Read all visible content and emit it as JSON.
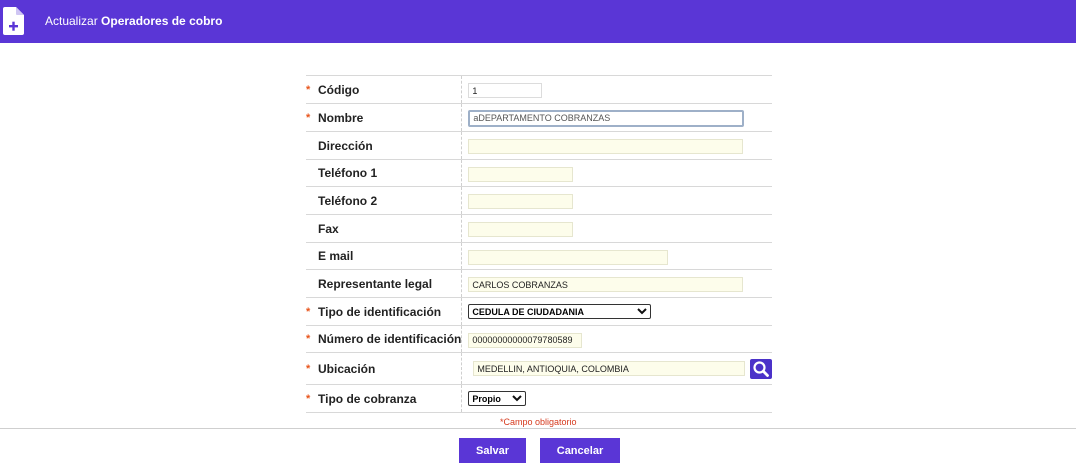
{
  "header": {
    "title_prefix": "Actualizar",
    "title_main": "Operadores de cobro"
  },
  "colors": {
    "brand": "#5a36d6",
    "required_marker": "#e8551c",
    "input_background": "#fdfdeb"
  },
  "form": {
    "required_mark": "*",
    "fields": {
      "codigo": {
        "label": "Código",
        "value": "1"
      },
      "nombre": {
        "label": "Nombre",
        "value": "aDEPARTAMENTO COBRANZAS"
      },
      "direccion": {
        "label": "Dirección",
        "value": ""
      },
      "telefono1": {
        "label": "Teléfono 1",
        "value": ""
      },
      "telefono2": {
        "label": "Teléfono 2",
        "value": ""
      },
      "fax": {
        "label": "Fax",
        "value": ""
      },
      "email": {
        "label": "E mail",
        "value": ""
      },
      "representante": {
        "label": "Representante legal",
        "value": "CARLOS COBRANZAS"
      },
      "tipo_id": {
        "label": "Tipo de identificación",
        "value": "CEDULA DE CIUDADANIA"
      },
      "numero_id": {
        "label": "Número de identificación",
        "value": "00000000000079780589"
      },
      "ubicacion": {
        "label": "Ubicación",
        "value": "MEDELLIN, ANTIOQUIA, COLOMBIA"
      },
      "tipo_cobranza": {
        "label": "Tipo de cobranza",
        "value": "Propio"
      }
    },
    "required_note": "Campo obligatorio"
  },
  "icons": {
    "header": "document-add-icon",
    "search": "search-icon",
    "dropdown": "chevron-down-icon"
  },
  "actions": {
    "save_label": "Salvar",
    "cancel_label": "Cancelar"
  }
}
